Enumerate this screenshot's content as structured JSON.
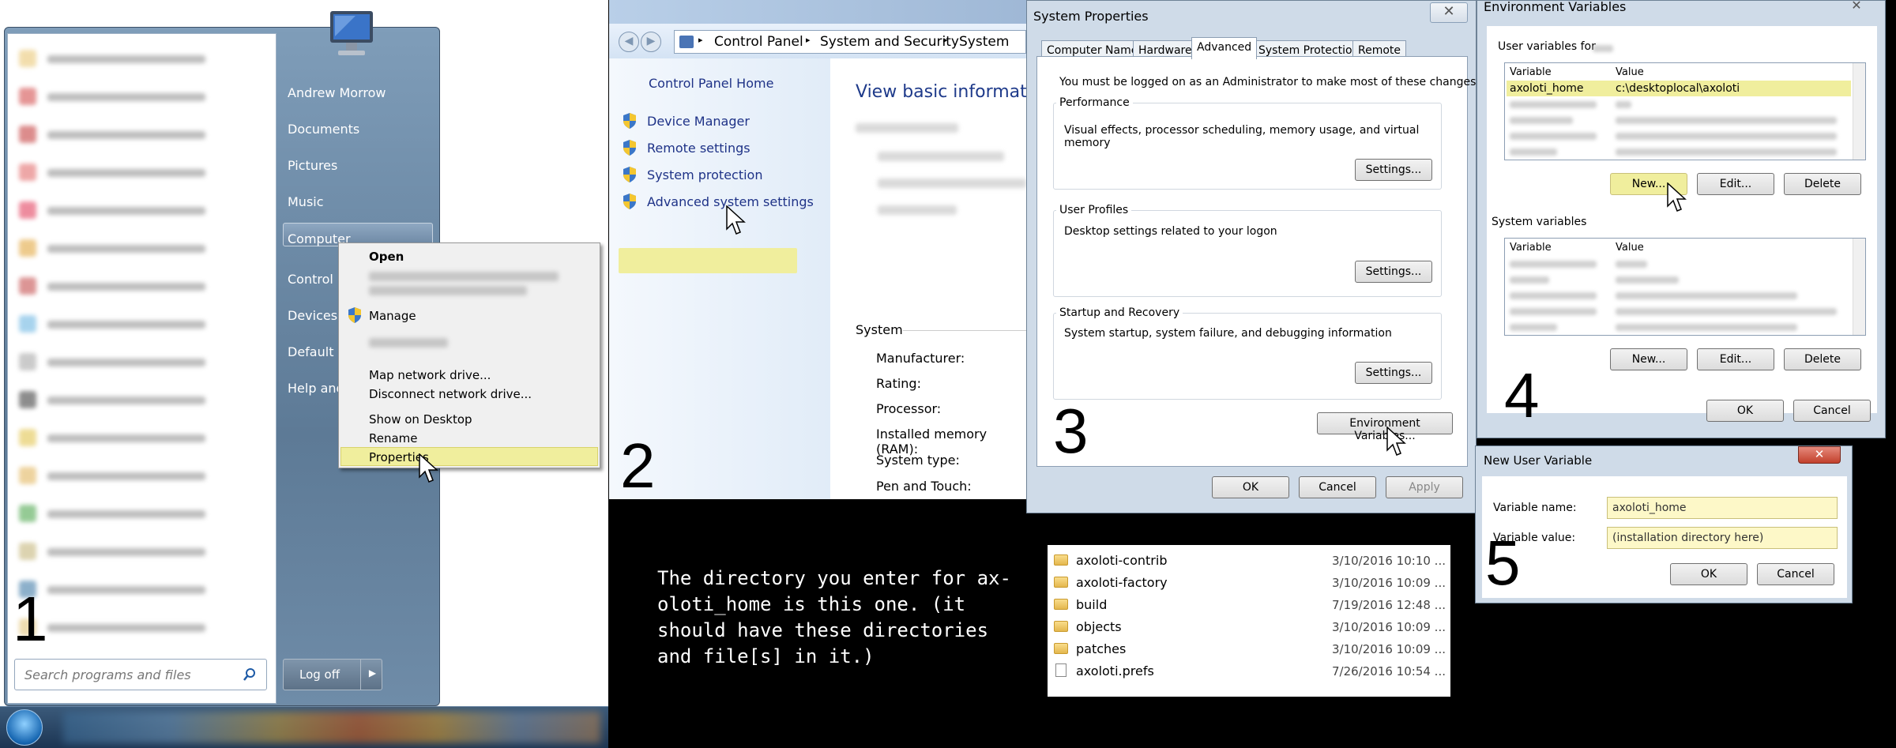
{
  "panel1": {
    "number": "1",
    "user": "Andrew Morrow",
    "right_items": [
      "Documents",
      "Pictures",
      "Music",
      "Computer",
      "Control P",
      "Devices a",
      "Default P",
      "Help and"
    ],
    "search_placeholder": "Search programs and files",
    "logoff": "Log off",
    "context_menu": {
      "open": "Open",
      "manage": "Manage",
      "map": "Map network drive...",
      "disconnect": "Disconnect network drive...",
      "show": "Show on Desktop",
      "rename": "Rename",
      "properties": "Properties"
    }
  },
  "panel2": {
    "number": "2",
    "breadcrumb": [
      "Control Panel",
      "System and Security",
      "System"
    ],
    "home": "Control Panel Home",
    "links": [
      "Device Manager",
      "Remote settings",
      "System protection",
      "Advanced system settings"
    ],
    "heading": "View basic information",
    "system_label": "System",
    "fields": [
      "Manufacturer:",
      "Rating:",
      "Processor:",
      "Installed memory (RAM):",
      "System type:",
      "Pen and Touch:"
    ]
  },
  "panel3": {
    "number": "3",
    "title": "System Properties",
    "tabs": [
      "Computer Name",
      "Hardware",
      "Advanced",
      "System Protection",
      "Remote"
    ],
    "admin_note": "You must be logged on as an Administrator to make most of these changes.",
    "performance": {
      "label": "Performance",
      "text": "Visual effects, processor scheduling, memory usage, and virtual memory",
      "button": "Settings..."
    },
    "profiles": {
      "label": "User Profiles",
      "text": "Desktop settings related to your logon",
      "button": "Settings..."
    },
    "startup": {
      "label": "Startup and Recovery",
      "text": "System startup, system failure, and debugging information",
      "button": "Settings..."
    },
    "env_button": "Environment Variables...",
    "ok": "OK",
    "cancel": "Cancel",
    "apply": "Apply"
  },
  "panel4": {
    "number": "4",
    "title": "Environment Variables",
    "user_vars_label": "User variables for",
    "col_variable": "Variable",
    "col_value": "Value",
    "selected_var": "axoloti_home",
    "selected_value": "c:\\desktoplocal\\axoloti",
    "system_vars_label": "System variables",
    "new": "New...",
    "edit": "Edit...",
    "delete": "Delete",
    "ok": "OK",
    "cancel": "Cancel"
  },
  "panel5": {
    "number": "5",
    "title": "New User Variable",
    "name_label": "Variable name:",
    "name_value": "axoloti_home",
    "value_label": "Variable value:",
    "value_value": "(installation directory here)",
    "ok": "OK",
    "cancel": "Cancel"
  },
  "explorer": {
    "rows": [
      {
        "name": "axoloti-contrib",
        "date": "3/10/2016 10:10 ..."
      },
      {
        "name": "axoloti-factory",
        "date": "3/10/2016 10:09 ..."
      },
      {
        "name": "build",
        "date": "7/19/2016 12:48 ..."
      },
      {
        "name": "objects",
        "date": "3/10/2016 10:09 ..."
      },
      {
        "name": "patches",
        "date": "3/10/2016 10:09 ..."
      },
      {
        "name": "axoloti.prefs",
        "date": "7/26/2016 10:54 ..."
      }
    ]
  },
  "caption": "The directory you enter for ax-\noloti_home is this one.  (it\nshould have these directories\nand file[s] in it.)",
  "colors": {
    "highlight": "#f0ee9d",
    "link": "#1e3287"
  }
}
